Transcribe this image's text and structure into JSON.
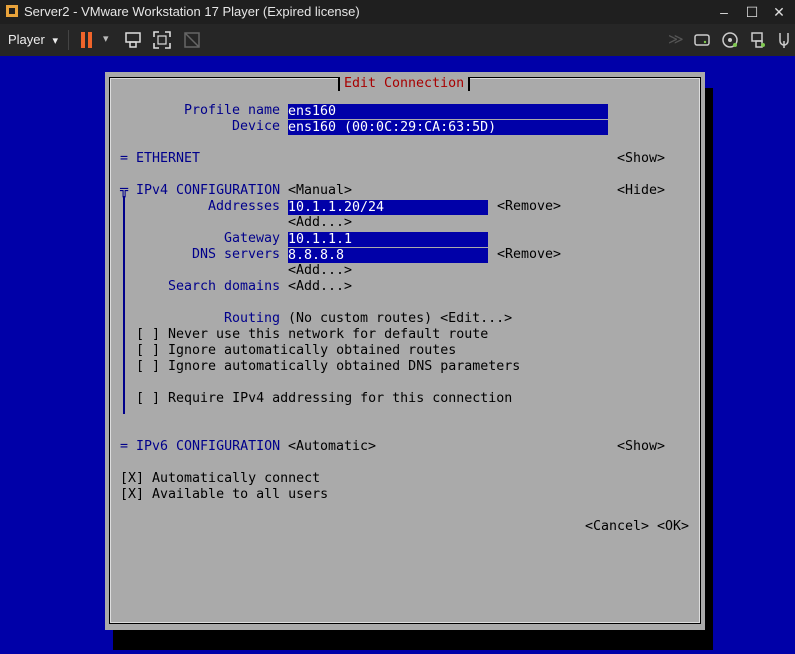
{
  "window": {
    "title": "Server2 - VMware Workstation 17 Player (Expired license)",
    "minimize": "–",
    "maximize": "☐",
    "close": "✕"
  },
  "toolbar": {
    "player_label": "Player",
    "player_arrow": "▾",
    "pause_arrow": "▾",
    "devices_arrows": "≫"
  },
  "dialog": {
    "title": "Edit Connection",
    "profile_name_label": "Profile name",
    "profile_name_value": "ens160",
    "device_label": "Device",
    "device_value": "ens160 (00:0C:29:CA:63:5D)",
    "ethernet_header": "= ETHERNET",
    "ethernet_toggle": "<Show>",
    "ipv4_header": "╦ IPv4 CONFIGURATION",
    "ipv4_mode": "<Manual>",
    "ipv4_toggle": "<Hide>",
    "addresses_label": "Addresses",
    "address_value": "10.1.1.20/24",
    "remove_address": "<Remove>",
    "add_address": "<Add...>",
    "gateway_label": "Gateway",
    "gateway_value": "10.1.1.1",
    "dns_label": "DNS servers",
    "dns_value": "8.8.8.8",
    "remove_dns": "<Remove>",
    "add_dns": "<Add...>",
    "search_domains_label": "Search domains",
    "add_search_domain": "<Add...>",
    "routing_label": "Routing",
    "routing_value": "(No custom routes) <Edit...>",
    "never_default_route": "[ ] Never use this network for default route",
    "ignore_routes": "[ ] Ignore automatically obtained routes",
    "ignore_dns": "[ ] Ignore automatically obtained DNS parameters",
    "require_ipv4": "[ ] Require IPv4 addressing for this connection",
    "ipv6_header": "= IPv6 CONFIGURATION",
    "ipv6_mode": "<Automatic>",
    "ipv6_toggle": "<Show>",
    "auto_connect": "[X] Automatically connect",
    "all_users": "[X] Available to all users",
    "cancel": "<Cancel>",
    "ok": "<OK>"
  },
  "colors": {
    "guest_background": "#0000a8",
    "dialog_background": "#aaaaaa",
    "label_color": "#00008b",
    "title_color": "#a80000",
    "field_background": "#0000a8",
    "pause_icon": "#f0642a"
  }
}
